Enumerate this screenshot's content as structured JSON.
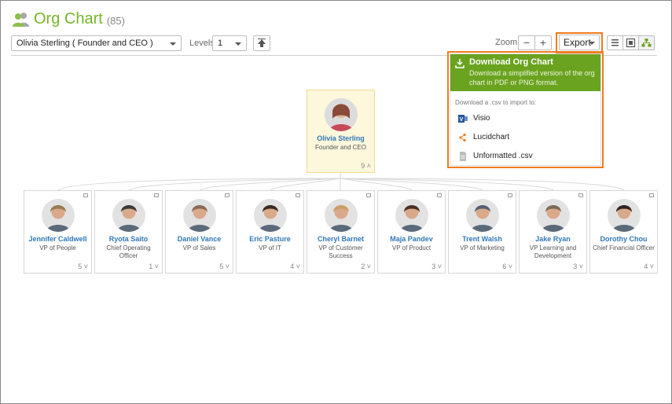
{
  "header": {
    "title": "Org Chart",
    "count": "(85)"
  },
  "toolbar": {
    "person_select_value": "Olivia Sterling  ( Founder and CEO )",
    "levels_label": "Levels",
    "levels_value": "1",
    "zoom_label": "Zoom",
    "zoom_minus": "−",
    "zoom_plus": "+",
    "export_label": "Export"
  },
  "export_menu": {
    "primary_title": "Download Org Chart",
    "primary_desc": "Download a simplified version of the org chart in PDF or PNG format.",
    "caption": "Download a .csv to import to:",
    "items": [
      {
        "label": "Visio",
        "icon": "visio-icon"
      },
      {
        "label": "Lucidchart",
        "icon": "lucidchart-icon"
      },
      {
        "label": "Unformatted .csv",
        "icon": "csv-file-icon"
      }
    ]
  },
  "root": {
    "name": "Olivia Sterling",
    "role": "Founder and CEO",
    "count": "9",
    "avatar_color": "#8a4a3a"
  },
  "reports": [
    {
      "name": "Jennifer Caldwell",
      "role": "VP of People",
      "count": "5",
      "avatar_color": "#9a7a55"
    },
    {
      "name": "Ryota Saito",
      "role": "Chief Operating Officer",
      "count": "1",
      "avatar_color": "#3a3a3a"
    },
    {
      "name": "Daniel Vance",
      "role": "VP of Sales",
      "count": "5",
      "avatar_color": "#8a6a55"
    },
    {
      "name": "Eric Pasture",
      "role": "VP of IT",
      "count": "4",
      "avatar_color": "#3b2a22"
    },
    {
      "name": "Cheryl Barnet",
      "role": "VP of Customer Success",
      "count": "2",
      "avatar_color": "#c9a060"
    },
    {
      "name": "Maja Pandev",
      "role": "VP of Product",
      "count": "3",
      "avatar_color": "#4a3028"
    },
    {
      "name": "Trent Walsh",
      "role": "VP of Marketing",
      "count": "6",
      "avatar_color": "#556070"
    },
    {
      "name": "Jake Ryan",
      "role": "VP Learning and Development",
      "count": "3",
      "avatar_color": "#7a6a5a"
    },
    {
      "name": "Dorothy Chou",
      "role": "Chief Financial Officer",
      "count": "4",
      "avatar_color": "#2e2420"
    }
  ],
  "colors": {
    "brand_green": "#75b62a",
    "menu_green": "#6aa31f",
    "highlight_orange": "#f07c1f",
    "name_blue": "#2f78b7"
  }
}
